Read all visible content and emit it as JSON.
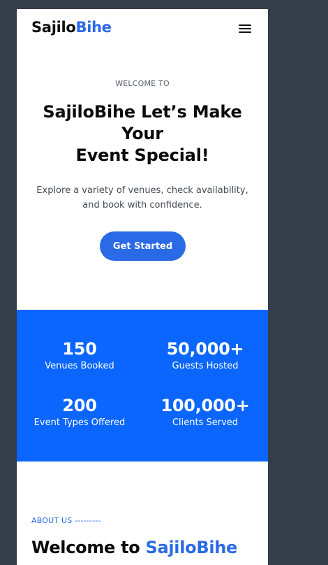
{
  "header": {
    "brand_part1": "Sajilo",
    "brand_part2": "Bihe",
    "menu_icon": "hamburger-menu-icon"
  },
  "hero": {
    "eyebrow": "WELCOME TO",
    "title_line1": "SajiloBihe Let’s Make",
    "title_line2": "Your",
    "title_line3": "Event Special!",
    "subtitle": "Explore a variety of venues, check availability, and book with confidence.",
    "cta_label": "Get Started"
  },
  "stats": [
    {
      "value": "150",
      "label": "Venues Booked"
    },
    {
      "value": "50,000+",
      "label": "Guests Hosted"
    },
    {
      "value": "200",
      "label": "Event Types Offered"
    },
    {
      "value": "100,000+",
      "label": "Clients Served"
    }
  ],
  "about": {
    "eyebrow": "ABOUT US ---------",
    "title_prefix": "Welcome to ",
    "title_brand": "SajiloBihe"
  },
  "colors": {
    "accent": "#2b6ae6",
    "stats_background": "#0a66fe",
    "backdrop": "#353d4b"
  }
}
